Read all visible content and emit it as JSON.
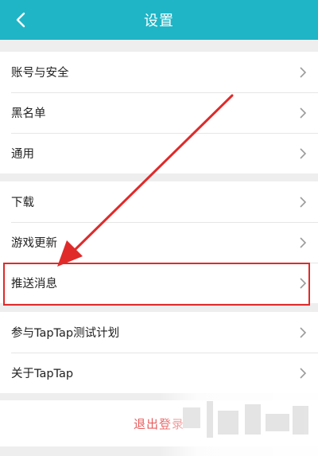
{
  "header": {
    "title": "设置",
    "back_icon": "chevron-left-icon"
  },
  "groups": [
    {
      "items": [
        {
          "label": "账号与安全"
        },
        {
          "label": "黑名单"
        },
        {
          "label": "通用"
        }
      ]
    },
    {
      "items": [
        {
          "label": "下载"
        },
        {
          "label": "游戏更新"
        },
        {
          "label": "推送消息"
        }
      ]
    },
    {
      "items": [
        {
          "label": "参与TapTap测试计划"
        },
        {
          "label": "关于TapTap"
        }
      ]
    }
  ],
  "logout": {
    "label": "退出登录"
  },
  "colors": {
    "header": "#1fb5c6",
    "annotation": "#e02a2a",
    "logout": "#e85c5c"
  }
}
